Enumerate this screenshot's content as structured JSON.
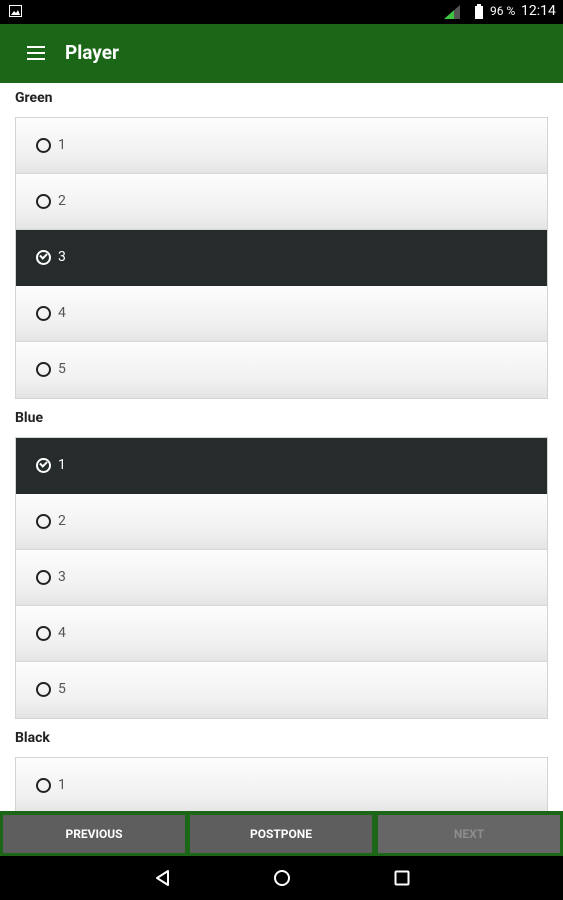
{
  "status_bar": {
    "battery_percent": "96 %",
    "time": "12:14",
    "icons": [
      "image-icon",
      "signal-icon",
      "battery-icon"
    ]
  },
  "app_bar": {
    "title": "Player",
    "menu_icon": "hamburger-menu-icon"
  },
  "sections": [
    {
      "label": "Green",
      "options": [
        {
          "label": "1",
          "selected": false
        },
        {
          "label": "2",
          "selected": false
        },
        {
          "label": "3",
          "selected": true
        },
        {
          "label": "4",
          "selected": false
        },
        {
          "label": "5",
          "selected": false
        }
      ]
    },
    {
      "label": "Blue",
      "options": [
        {
          "label": "1",
          "selected": true
        },
        {
          "label": "2",
          "selected": false
        },
        {
          "label": "3",
          "selected": false
        },
        {
          "label": "4",
          "selected": false
        },
        {
          "label": "5",
          "selected": false
        }
      ]
    },
    {
      "label": "Black",
      "options": [
        {
          "label": "1",
          "selected": false
        }
      ]
    }
  ],
  "actions": {
    "previous": "PREVIOUS",
    "postpone": "POSTPONE",
    "next": "NEXT",
    "next_enabled": false
  },
  "colors": {
    "primary_green": "#1b6617",
    "selected_row": "#252c2b",
    "button_gray": "#5e5e5e"
  },
  "nav_bar": {
    "icons": [
      "back-icon",
      "home-icon",
      "recents-icon"
    ]
  }
}
